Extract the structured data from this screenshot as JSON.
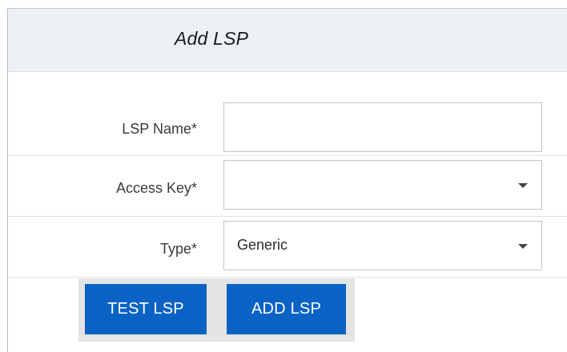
{
  "dialog": {
    "title": "Add LSP"
  },
  "form": {
    "lsp_name": {
      "label": "LSP Name*",
      "value": ""
    },
    "access_key": {
      "label": "Access Key*",
      "selected": "",
      "icon": "chevron-down-icon"
    },
    "type": {
      "label": "Type*",
      "selected": "Generic",
      "icon": "chevron-down-icon"
    }
  },
  "actions": {
    "test_label": "TEST LSP",
    "add_label": "ADD LSP"
  },
  "colors": {
    "header_bg": "#edf0f4",
    "button_bg": "#0a63c4",
    "button_bar_bg": "#e4e4e4"
  }
}
